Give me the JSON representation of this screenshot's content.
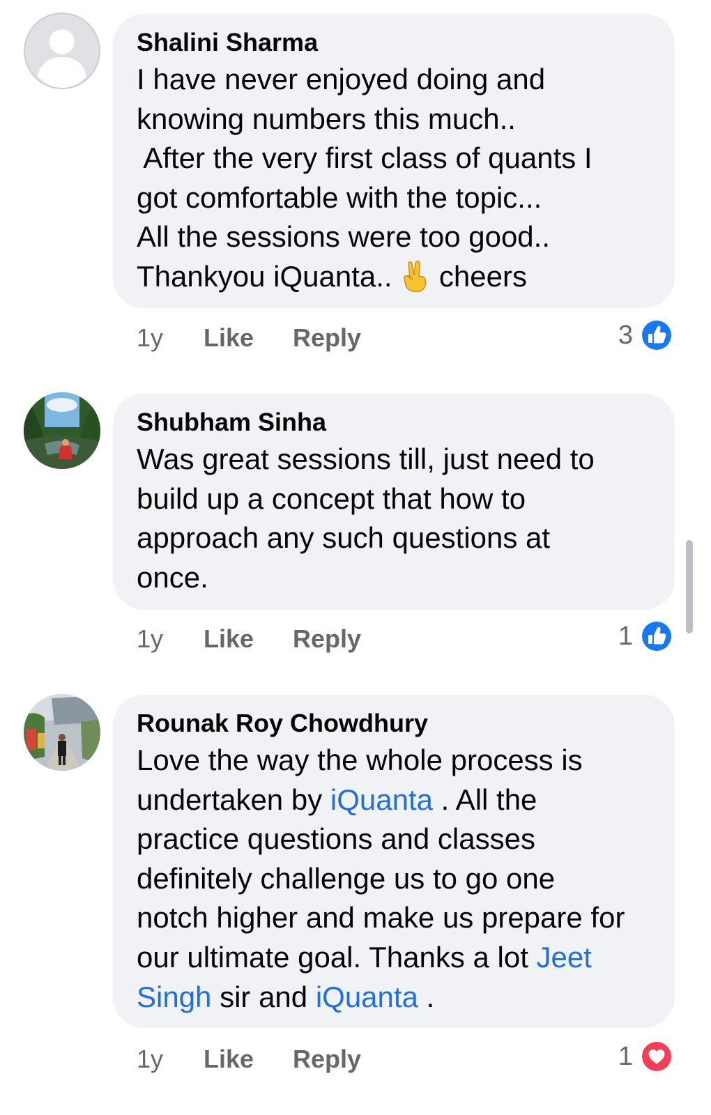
{
  "comments": [
    {
      "author": "Shalini Sharma",
      "lines": [
        "I have never enjoyed doing and",
        "knowing numbers this much..",
        " After the very first class of quants I",
        "got comfortable with the topic...",
        "All the sessions were too good.."
      ],
      "last_line_before_emoji": "Thankyou iQuanta.. ",
      "emoji": "victory-hand-emoji",
      "last_line_after_emoji": " cheers",
      "time": "1y",
      "like": "Like",
      "reply": "Reply",
      "reaction_count": "3",
      "reaction_type": "like-icon"
    },
    {
      "author": "Shubham Sinha",
      "lines": [
        "Was great sessions till, just need to",
        "build up a concept that how to",
        "approach any such questions at",
        "once."
      ],
      "time": "1y",
      "like": "Like",
      "reply": "Reply",
      "reaction_count": "1",
      "reaction_type": "like-icon"
    },
    {
      "author": "Rounak Roy Chowdhury",
      "line1": "Love the way the whole process is",
      "line2_pre": "undertaken by ",
      "line2_link": "iQuanta",
      "line2_post": " . All the",
      "line3": "practice questions and classes",
      "line4": "definitely challenge us to go one",
      "line5": "notch higher and make us prepare for",
      "line6_pre": "our ultimate goal. Thanks a lot ",
      "line6_link": "Jeet",
      "line7_link": "Singh",
      "line7_mid": " sir and ",
      "line7_link2": "iQuanta",
      "line7_post": " .",
      "time": "1y",
      "like": "Like",
      "reply": "Reply",
      "reaction_count": "1",
      "reaction_type": "love-icon"
    }
  ],
  "colors": {
    "bubble": "#f0f2f5",
    "link": "#216fdb",
    "like_blue": "#1877f2",
    "love_red": "#f33e58",
    "meta_gray": "#65676b"
  }
}
